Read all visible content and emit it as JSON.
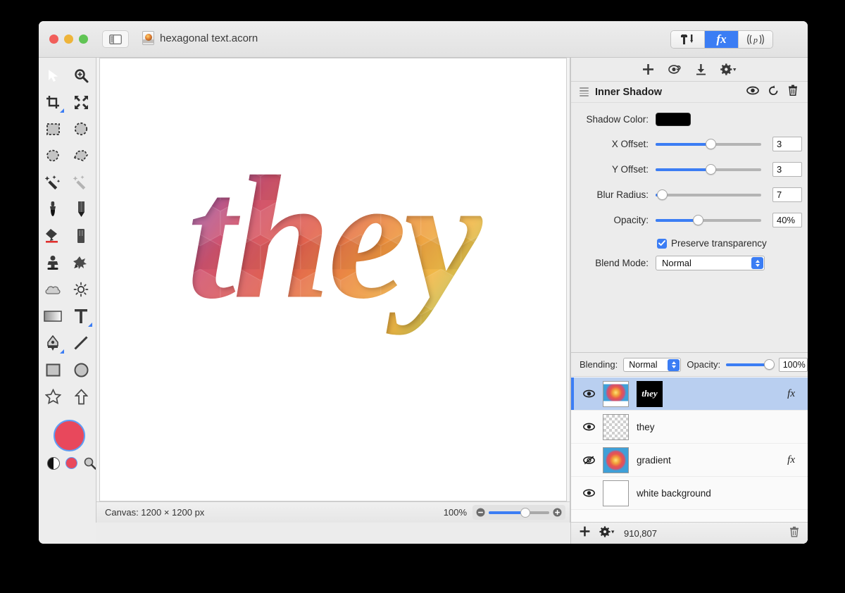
{
  "window": {
    "document_title": "hexagonal text.acorn",
    "doc_icon": "acorn-document-icon",
    "sidebar_toggle_icon": "sidebar-toggle-icon",
    "traffic_lights": [
      "close-button",
      "minimize-button",
      "zoom-button"
    ]
  },
  "inspector_tabs": [
    {
      "id": "tools",
      "icon": "hammer-tool-icon",
      "label": "",
      "active": false
    },
    {
      "id": "filters",
      "icon": "fx-icon",
      "label": "fx",
      "active": true
    },
    {
      "id": "palette",
      "icon": "palette-icon",
      "label": "p",
      "active": false
    }
  ],
  "tool_palette": {
    "tools": [
      {
        "name": "move-tool",
        "icon": "cursor-arrow-icon",
        "selected": true,
        "submenu": false
      },
      {
        "name": "zoom-tool",
        "icon": "magnifier-plus-icon",
        "selected": false,
        "submenu": false
      },
      {
        "name": "crop-tool",
        "icon": "crop-icon",
        "selected": false,
        "submenu": true
      },
      {
        "name": "transform-tool",
        "icon": "move-arrows-icon",
        "selected": false,
        "submenu": false
      },
      {
        "name": "rectangular-select-tool",
        "icon": "marquee-rect-icon",
        "selected": false,
        "submenu": false
      },
      {
        "name": "elliptical-select-tool",
        "icon": "marquee-ellipse-icon",
        "selected": false,
        "submenu": false
      },
      {
        "name": "lasso-tool",
        "icon": "lasso-icon",
        "selected": false,
        "submenu": false
      },
      {
        "name": "polygon-select-tool",
        "icon": "polygon-lasso-icon",
        "selected": false,
        "submenu": false
      },
      {
        "name": "magic-wand-tool",
        "icon": "magic-wand-icon",
        "selected": false,
        "submenu": false
      },
      {
        "name": "instant-alpha-tool",
        "icon": "instant-alpha-icon",
        "selected": false,
        "submenu": false
      },
      {
        "name": "brush-tool",
        "icon": "brush-icon",
        "selected": false,
        "submenu": false
      },
      {
        "name": "pencil-tool",
        "icon": "pencil-icon",
        "selected": false,
        "submenu": false
      },
      {
        "name": "paint-bucket-tool",
        "icon": "paint-bucket-icon",
        "selected": false,
        "submenu": false
      },
      {
        "name": "eraser-tool",
        "icon": "eraser-icon",
        "selected": false,
        "submenu": false
      },
      {
        "name": "clone-stamp-tool",
        "icon": "clone-stamp-icon",
        "selected": false,
        "submenu": false
      },
      {
        "name": "smudge-tool",
        "icon": "smudge-icon",
        "selected": false,
        "submenu": false
      },
      {
        "name": "blur-tool",
        "icon": "cloud-blur-icon",
        "selected": false,
        "submenu": false
      },
      {
        "name": "dodge-tool",
        "icon": "sun-dodge-icon",
        "selected": false,
        "submenu": false
      },
      {
        "name": "gradient-tool",
        "icon": "gradient-icon",
        "selected": false,
        "submenu": false
      },
      {
        "name": "text-tool",
        "icon": "text-t-icon",
        "selected": false,
        "submenu": true
      },
      {
        "name": "bezier-tool",
        "icon": "pen-nib-icon",
        "selected": false,
        "submenu": true
      },
      {
        "name": "line-tool",
        "icon": "line-icon",
        "selected": false,
        "submenu": false
      },
      {
        "name": "rectangle-tool",
        "icon": "rectangle-shape-icon",
        "selected": false,
        "submenu": false
      },
      {
        "name": "ellipse-tool",
        "icon": "ellipse-shape-icon",
        "selected": false,
        "submenu": false
      },
      {
        "name": "star-tool",
        "icon": "star-shape-icon",
        "selected": false,
        "submenu": false
      },
      {
        "name": "arrow-tool",
        "icon": "arrow-shape-icon",
        "selected": false,
        "submenu": false
      }
    ],
    "colors": {
      "foreground": "#e8485c",
      "swap_icon": "black-white-swap-icon",
      "recent_icon": "recent-color-swatch",
      "picker_icon": "magnifier-color-picker-icon"
    }
  },
  "canvas": {
    "artwork_text": "they",
    "artwork_style": "hexagonal rainbow gradient italic script",
    "background": "#ffffff"
  },
  "status_bar": {
    "canvas_size": "Canvas: 1200 × 1200 px",
    "zoom_level": "100%",
    "zoom_out_icon": "zoom-out-icon",
    "zoom_in_icon": "zoom-in-icon"
  },
  "filter_toolbar": {
    "add_icon": "plus-icon",
    "preset_icon": "preset-eye-icon",
    "import_icon": "download-arrow-icon",
    "settings_icon": "gear-dropdown-icon"
  },
  "filter": {
    "drag_handle_icon": "hamburger-drag-icon",
    "name": "Inner Shadow",
    "visibility_icon": "eye-icon",
    "reset_icon": "reset-arrow-icon",
    "delete_icon": "trash-icon",
    "params": [
      {
        "label": "Shadow Color:",
        "type": "color",
        "value": "#000000",
        "name": "shadow-color-well"
      },
      {
        "label": "X Offset:",
        "type": "slider",
        "value": "3",
        "fill_pct": 52,
        "name": "x-offset"
      },
      {
        "label": "Y Offset:",
        "type": "slider",
        "value": "3",
        "fill_pct": 52,
        "name": "y-offset"
      },
      {
        "label": "Blur Radius:",
        "type": "slider",
        "value": "7",
        "fill_pct": 7,
        "name": "blur-radius"
      },
      {
        "label": "Opacity:",
        "type": "slider",
        "value": "40%",
        "fill_pct": 40,
        "name": "opacity"
      }
    ],
    "preserve_transparency": {
      "label": "Preserve transparency",
      "checked": true
    },
    "blend_mode": {
      "label": "Blend Mode:",
      "value": "Normal"
    }
  },
  "layers_panel": {
    "blending_label": "Blending:",
    "blending_value": "Normal",
    "opacity_label": "Opacity:",
    "opacity_value": "100%",
    "opacity_pct": 100,
    "layers": [
      {
        "name": "",
        "visible": true,
        "selected": true,
        "has_fx": true,
        "thumb": "gradient-framed",
        "mask_thumb": "they",
        "display_name": ""
      },
      {
        "name": "they",
        "visible": true,
        "selected": false,
        "has_fx": false,
        "thumb": "checker",
        "mask_thumb": null,
        "display_name": "they"
      },
      {
        "name": "gradient",
        "visible": false,
        "selected": false,
        "has_fx": true,
        "thumb": "gradient",
        "mask_thumb": null,
        "display_name": "gradient"
      },
      {
        "name": "white background",
        "visible": true,
        "selected": false,
        "has_fx": false,
        "thumb": "white",
        "mask_thumb": null,
        "display_name": "white background"
      }
    ],
    "footer": {
      "add_icon": "plus-icon",
      "settings_icon": "gear-dropdown-icon",
      "count": "910,807",
      "delete_icon": "trash-icon"
    }
  }
}
